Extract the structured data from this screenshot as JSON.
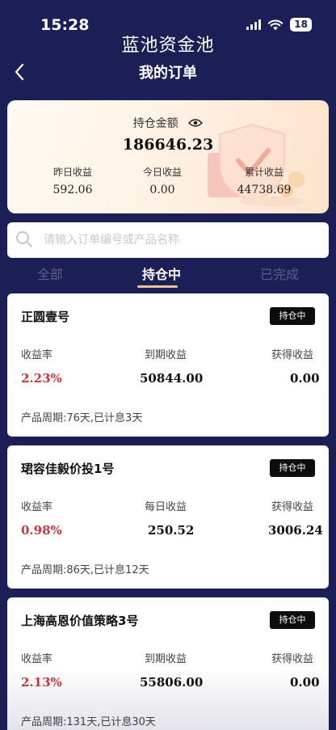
{
  "status_bar": {
    "time": "15:28",
    "battery": "18"
  },
  "app_title": "蓝池资金池",
  "nav": {
    "title": "我的订单"
  },
  "summary": {
    "holding_label": "持仓金额",
    "holding_amount": "186646.23",
    "stats": [
      {
        "label": "昨日收益",
        "value": "592.06"
      },
      {
        "label": "今日收益",
        "value": "0.00"
      },
      {
        "label": "累计收益",
        "value": "44738.69"
      }
    ]
  },
  "search": {
    "placeholder": "请输入订单编号或产品名称",
    "value": ""
  },
  "tabs": [
    {
      "label": "全部",
      "active": false
    },
    {
      "label": "持仓中",
      "active": true
    },
    {
      "label": "已完成",
      "active": false
    }
  ],
  "orders": [
    {
      "name": "正圆壹号",
      "status": "持仓中",
      "rate_label": "收益率",
      "rate": "2.23%",
      "mid_label": "到期收益",
      "mid_value": "50844.00",
      "earned_label": "获得收益",
      "earned": "0.00",
      "period": "产品周期:76天,已计息3天"
    },
    {
      "name": "珺容佳毅价投1号",
      "status": "持仓中",
      "rate_label": "收益率",
      "rate": "0.98%",
      "mid_label": "每日收益",
      "mid_value": "250.52",
      "earned_label": "获得收益",
      "earned": "3006.24",
      "period": "产品周期:86天,已计息12天"
    },
    {
      "name": "上海高恩价值策略3号",
      "status": "持仓中",
      "rate_label": "收益率",
      "rate": "2.13%",
      "mid_label": "到期收益",
      "mid_value": "55806.00",
      "earned_label": "获得收益",
      "earned": "0.00",
      "period": "产品周期:131天,已计息30天"
    }
  ],
  "colors": {
    "background": "#1c1f55",
    "rate_red": "#c8373b",
    "tab_underline": "#e6c79c"
  }
}
